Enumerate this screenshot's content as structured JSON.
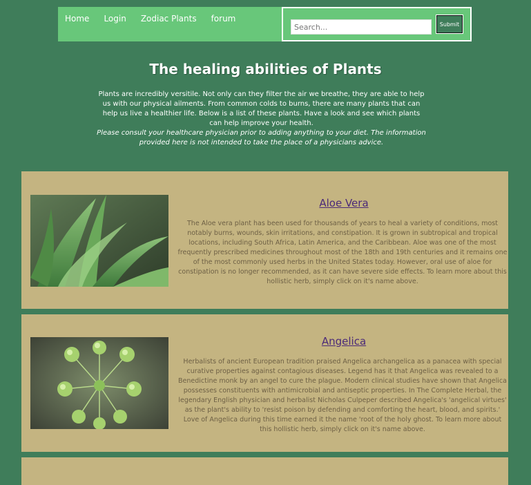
{
  "nav": {
    "links": [
      "Home",
      "Login",
      "Zodiac Plants",
      "forum"
    ],
    "search_placeholder": "Search...",
    "submit_label": "Submit"
  },
  "header": {
    "title": "The healing abilities of Plants",
    "intro": "Plants are incredibly versitile. Not only can they filter the air we breathe, they are able to help us with our physical ailments. From common colds to burns, there are many plants that can help us live a healthier life. Below is a list of these plants. Have a look and see which plants can help improve your health.",
    "disclaimer": "Please consult your healthcare physician prior to adding anything to your diet. The information provided here is not intended to take the place of a physicians advice."
  },
  "plants": [
    {
      "name": "Aloe Vera",
      "description": "The Aloe vera plant has been used for thousands of years to heal a variety of conditions, most notably burns, wounds, skin irritations, and constipation. It is grown in subtropical and tropical locations, including South Africa, Latin America, and the Caribbean. Aloe was one of the most frequently prescribed medicines throughout most of the 18th and 19th centuries and it remains one of the most commonly used herbs in the United States today. However, oral use of aloe for constipation is no longer recommended, as it can have severe side effects. To learn more about this hollistic herb, simply click on it's name above."
    },
    {
      "name": "Angelica",
      "description": "Herbalists of ancient European tradition praised Angelica archangelica as a panacea with special curative properties against contagious diseases. Legend has it that Angelica was revealed to a Benedictine monk by an angel to cure the plague. Modern clinical studies have shown that Angelica possesses constituents with antimicrobial and antiseptic properties. In The Complete Herbal, the legendary English physician and herbalist Nicholas Culpeper described Angelica's 'angelical virtues' as the plant's ability to 'resist poison by defending and comforting the heart, blood, and spirits.' Love of Angelica during this time earned it the name 'root of the holy ghost. To learn more about this hollistic herb, simply click on it's name above."
    }
  ]
}
